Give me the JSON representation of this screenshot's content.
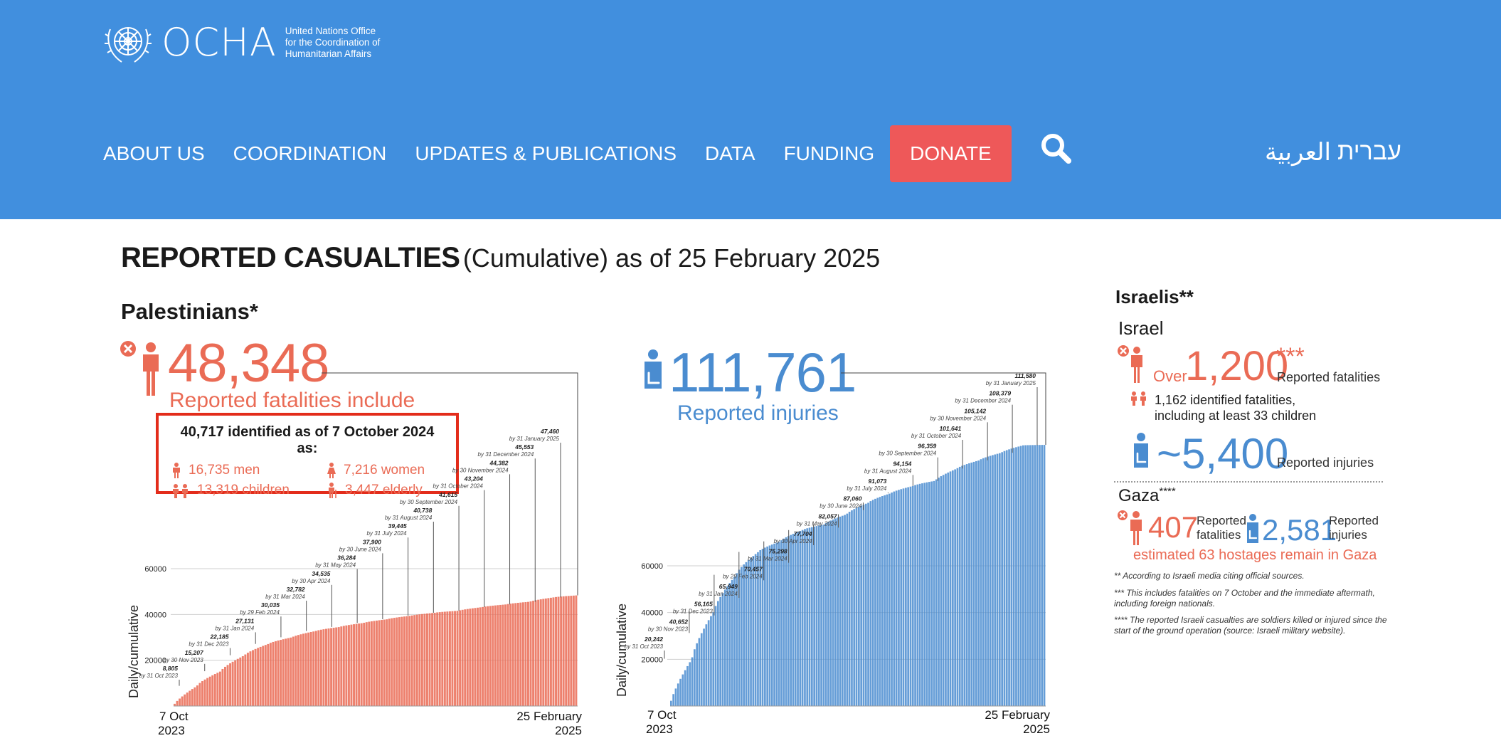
{
  "header": {
    "logo_word": "OCHA",
    "logo_sub": [
      "United Nations Office",
      "for the Coordination of",
      "Humanitarian Affairs"
    ],
    "nav": [
      "ABOUT US",
      "COORDINATION",
      "UPDATES & PUBLICATIONS",
      "DATA",
      "FUNDING"
    ],
    "donate": "DONATE",
    "search_icon": "search-icon",
    "lang_ar": "العربية",
    "lang_he": "עברית"
  },
  "colors": {
    "header_bg": "#418fde",
    "donate_bg": "#ee5859",
    "fatalities": "#ea6b55",
    "injuries": "#4a8cd0",
    "box_border": "#e32c1b"
  },
  "main": {
    "title_bold": "REPORTED CASUALTIES",
    "title_rest": "(Cumulative) as of 25 February 2025",
    "palestinians": "Palestinians*",
    "fatalities_total": "48,348",
    "fatalities_label": "Reported fatalities include",
    "identified_title": "40,717 identified as of 7 October 2024 as:",
    "identified": {
      "men": "16,735 men",
      "women": "7,216 women",
      "children": "13,319 children",
      "elderly": "3,447 elderly"
    },
    "injuries_total": "111,761",
    "injuries_label": "Reported injuries"
  },
  "chart_data": [
    {
      "type": "bar",
      "series": [
        {
          "name": "Reported fatalities",
          "color": "#ea6b55"
        }
      ],
      "ylabel": "Daily/cumulative",
      "y_ticks": [
        20000,
        40000,
        60000
      ],
      "ylim": [
        0,
        62000
      ],
      "x_start": [
        "7 Oct",
        "2023"
      ],
      "x_end": [
        "25 February",
        "2025"
      ],
      "start_value": 0,
      "end_value": 48348,
      "annotations": [
        {
          "value": 8805,
          "label": "8,805",
          "date": "by 31 Oct 2023"
        },
        {
          "value": 15207,
          "label": "15,207",
          "date": "by 30 Nov 2023"
        },
        {
          "value": 22185,
          "label": "22,185",
          "date": "by 31 Dec 2023"
        },
        {
          "value": 27131,
          "label": "27,131",
          "date": "by 31 Jan 2024"
        },
        {
          "value": 30035,
          "label": "30,035",
          "date": "by 29 Feb 2024"
        },
        {
          "value": 32782,
          "label": "32,782",
          "date": "by 31 Mar 2024"
        },
        {
          "value": 34535,
          "label": "34,535",
          "date": "by 30 Apr 2024"
        },
        {
          "value": 36284,
          "label": "36,284",
          "date": "by 31 May 2024"
        },
        {
          "value": 37900,
          "label": "37,900",
          "date": "by 30 June 2024"
        },
        {
          "value": 39445,
          "label": "39,445",
          "date": "by 31 July 2024"
        },
        {
          "value": 40738,
          "label": "40,738",
          "date": "by 31 August 2024"
        },
        {
          "value": 41615,
          "label": "41,615",
          "date": "by 30 September 2024"
        },
        {
          "value": 43204,
          "label": "43,204",
          "date": "by 31 October 2024"
        },
        {
          "value": 44382,
          "label": "44,382",
          "date": "by 30 November 2024"
        },
        {
          "value": 45553,
          "label": "45,553",
          "date": "by 31 December 2024"
        },
        {
          "value": 47460,
          "label": "47,460",
          "date": "by 31 January 2025"
        }
      ]
    },
    {
      "type": "bar",
      "series": [
        {
          "name": "Reported injuries",
          "color": "#4a8cd0"
        }
      ],
      "ylabel": "Daily/cumulative",
      "y_ticks": [
        20000,
        40000,
        60000
      ],
      "ylim": [
        0,
        122000
      ],
      "x_start": [
        "7 Oct",
        "2023"
      ],
      "x_end": [
        "25 February",
        "2025"
      ],
      "start_value": 0,
      "end_value": 111761,
      "annotations": [
        {
          "value": 20242,
          "label": "20,242",
          "date": "by 31 Oct 2023"
        },
        {
          "value": 40652,
          "label": "40,652",
          "date": "by 30 Nov 2023"
        },
        {
          "value": 56165,
          "label": "56,165",
          "date": "by 31 Dec 2023"
        },
        {
          "value": 65949,
          "label": "65,949",
          "date": "by 31 Jan 2024"
        },
        {
          "value": 70457,
          "label": "70,457",
          "date": "by 29 Feb 2024"
        },
        {
          "value": 75298,
          "label": "75,298",
          "date": "by 31 Mar 2024"
        },
        {
          "value": 77704,
          "label": "77,704",
          "date": "by 30 Apr 2024"
        },
        {
          "value": 82057,
          "label": "82,057",
          "date": "by 31 May 2024"
        },
        {
          "value": 87060,
          "label": "87,060",
          "date": "by 30 June 2024"
        },
        {
          "value": 91073,
          "label": "91,073",
          "date": "by 31 July 2024"
        },
        {
          "value": 94154,
          "label": "94,154",
          "date": "by 31 August 2024"
        },
        {
          "value": 96359,
          "label": "96,359",
          "date": "by 30 September 2024"
        },
        {
          "value": 101641,
          "label": "101,641",
          "date": "by 31 October 2024"
        },
        {
          "value": 105142,
          "label": "105,142",
          "date": "by 30 November 2024"
        },
        {
          "value": 108379,
          "label": "108,379",
          "date": "by 31 December 2024"
        },
        {
          "value": 111580,
          "label": "111,580",
          "date": "by 31 January 2025"
        }
      ]
    }
  ],
  "israelis": {
    "heading": "Israelis**",
    "israel": "Israel",
    "over": "Over",
    "fatalities": "1,200",
    "fatal_stars": "***",
    "fatal_label": "Reported fatalities",
    "identified_1": "1,162 identified fatalities,",
    "identified_2": "including at least 33 children",
    "injuries": "~5,400",
    "inj_label": "Reported injuries",
    "gaza": "Gaza",
    "gaza_stars": "****",
    "gaza_fatal": "407",
    "gaza_fatal_l1": "Reported",
    "gaza_fatal_l2": "fatalities",
    "gaza_inj": "2,581",
    "gaza_inj_l1": "Reported",
    "gaza_inj_l2": "injuries",
    "hostages": "estimated 63 hostages remain in Gaza",
    "note1": "** According to Israeli media citing official sources.",
    "note2": "*** This includes fatalities on 7 October and the immediate aftermath, including foreign nationals.",
    "note3": "**** The reported Israeli casualties are soldiers killed or injured since the start of the ground operation (source: Israeli military website)."
  }
}
